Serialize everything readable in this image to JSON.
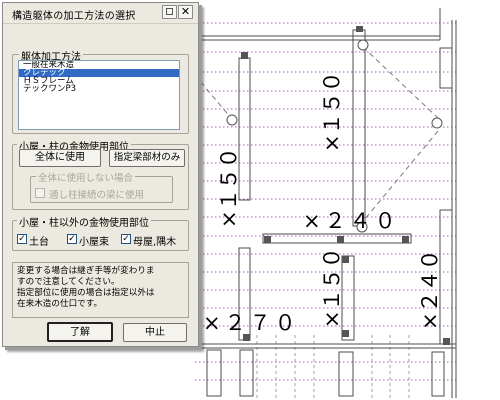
{
  "dialog": {
    "title": "構造躯体の加工方法の選択",
    "close_glyph": "✕",
    "method_group": {
      "legend": "躯体加工方法",
      "items": [
        "一般在来木造",
        "クレテック",
        "ＨＳフレーム",
        "テックワンP3"
      ],
      "selected_index": 1
    },
    "koya_group": {
      "legend": "小屋・柱の金物使用部位",
      "btn_all": "全体に使用",
      "btn_specified": "指定梁部材のみ",
      "subgroup": {
        "legend": "全体に使用しない場合",
        "checkbox_label": "通し柱接続の梁に使用",
        "checked": false
      }
    },
    "other_group": {
      "legend": "小屋・柱以外の金物使用部位",
      "checkboxes": [
        {
          "label": "土台",
          "checked": true
        },
        {
          "label": "小屋束",
          "checked": true
        },
        {
          "label": "母屋,隅木",
          "checked": true
        }
      ]
    },
    "message_lines": [
      "変更する場合は継ぎ手等が変わりま",
      "すので注意してください。",
      "指定部位に使用の場合は指定以外は",
      "在来木造の仕口です。"
    ],
    "ok_label": "了解",
    "cancel_label": "中止"
  },
  "drawing": {
    "dimensions": [
      "×１５０",
      "×１５０",
      "×２４０",
      "×１５０",
      "×２４０",
      "×２７０"
    ],
    "check_mark": "✓",
    "colors": {
      "grid_dotted": "#b44fc8",
      "member_line": "#4d4d4d",
      "dash_line": "#777777",
      "selection": "#316ac5"
    }
  }
}
